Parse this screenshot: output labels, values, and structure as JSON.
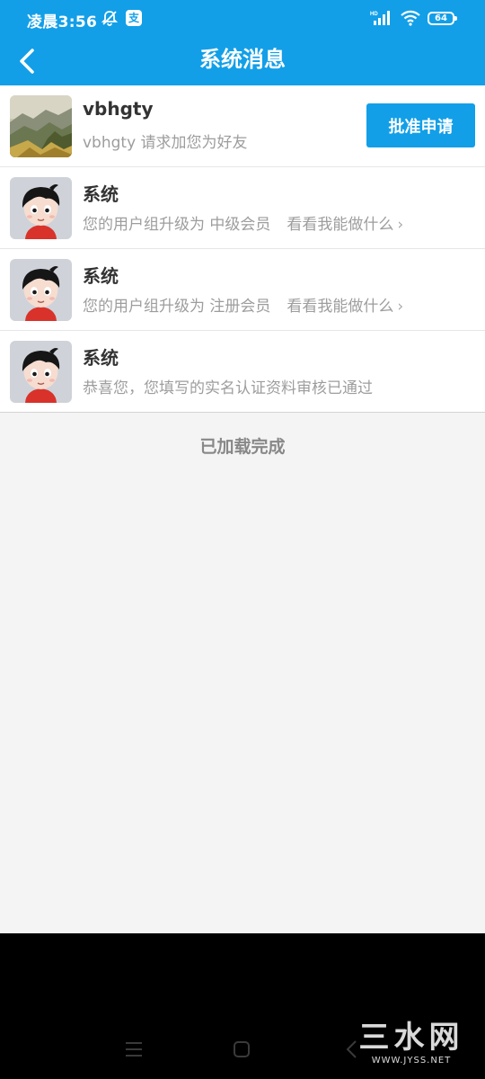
{
  "status_bar": {
    "time": "凌晨3:56",
    "alipay_badge": "支",
    "network_label": "HD",
    "battery_level": "64"
  },
  "header": {
    "title": "系统消息"
  },
  "messages": [
    {
      "title": "vbhgty",
      "text": "vbhgty 请求加您为好友",
      "action_label": "批准申请"
    },
    {
      "title": "系统",
      "text": "您的用户组升级为 中级会员",
      "link": "看看我能做什么",
      "link_icon": "›"
    },
    {
      "title": "系统",
      "text": "您的用户组升级为 注册会员",
      "link": "看看我能做什么",
      "link_icon": "›"
    },
    {
      "title": "系统",
      "text": "恭喜您，您填写的实名认证资料审核已通过"
    }
  ],
  "footer_status": "已加载完成",
  "watermark": {
    "main": "三水网",
    "sub": "WWW.JYSS.NET"
  },
  "colors": {
    "primary": "#129fe8",
    "background": "#f4f4f4",
    "title_text": "#333333",
    "secondary_text": "#9d9d9d"
  }
}
